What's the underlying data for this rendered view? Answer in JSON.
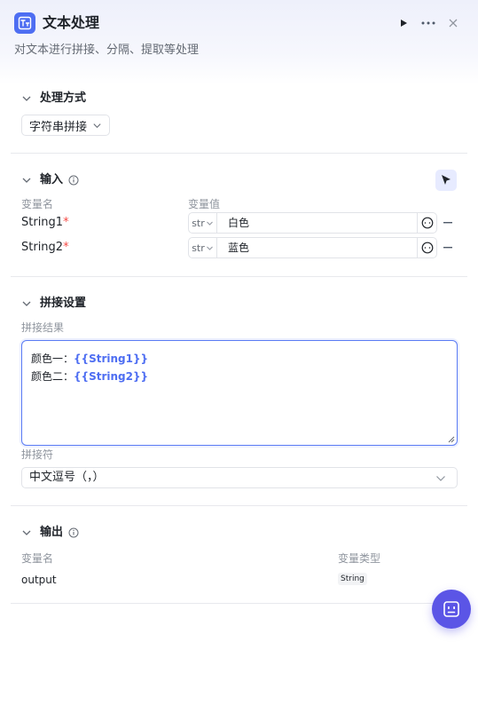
{
  "header": {
    "title": "文本处理",
    "subtitle": "对文本进行拼接、分隔、提取等处理"
  },
  "mode": {
    "section_title": "处理方式",
    "selected": "字符串拼接"
  },
  "input": {
    "section_title": "输入",
    "col_name": "变量名",
    "col_value": "变量值",
    "rows": [
      {
        "name": "String1",
        "required": "*",
        "type": "str",
        "value": "白色"
      },
      {
        "name": "String2",
        "required": "*",
        "type": "str",
        "value": "蓝色"
      }
    ]
  },
  "concat": {
    "section_title": "拼接设置",
    "result_label": "拼接结果",
    "lines": [
      {
        "prefix": "颜色一：",
        "var": "{{String1}}"
      },
      {
        "prefix": "颜色二：",
        "var": "{{String2}}"
      }
    ],
    "separator_label": "拼接符",
    "separator_value": "中文逗号（，）"
  },
  "output": {
    "section_title": "输出",
    "col_name": "变量名",
    "col_type": "变量类型",
    "rows": [
      {
        "name": "output",
        "type": "String"
      }
    ]
  },
  "colors": {
    "accent": "#4e6ef2",
    "fab": "#5b55e6",
    "required": "#f54a45"
  }
}
